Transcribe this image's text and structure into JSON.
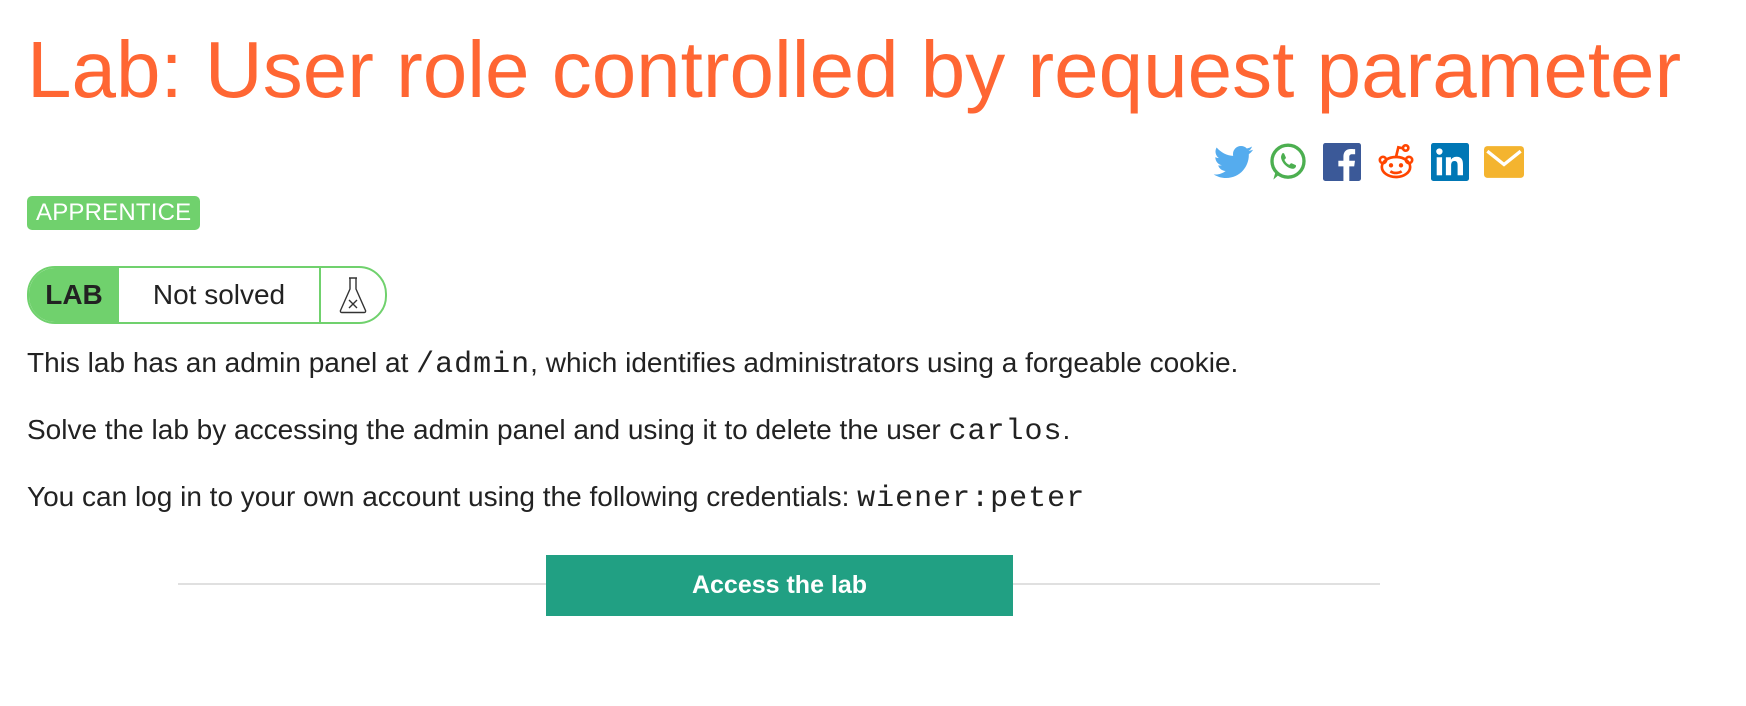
{
  "title": "Lab: User role controlled by request parameter",
  "share": {
    "icons": [
      "twitter-icon",
      "whatsapp-icon",
      "facebook-icon",
      "reddit-icon",
      "linkedin-icon",
      "email-icon"
    ],
    "colors": {
      "twitter": "#55acee",
      "whatsapp": "#4caf50",
      "facebook": "#3b5998",
      "reddit": "#ff4500",
      "linkedin": "#0077b5",
      "email": "#f4b42f"
    }
  },
  "level": "APPRENTICE",
  "status": {
    "tag": "LAB",
    "text": "Not solved",
    "icon": "flask-icon"
  },
  "description": {
    "p1_before": "This lab has an admin panel at ",
    "p1_code": "/admin",
    "p1_after": ", which identifies administrators using a forgeable cookie.",
    "p2_before": "Solve the lab by accessing the admin panel and using it to delete the user ",
    "p2_code": "carlos",
    "p2_after": ".",
    "p3_before": "You can log in to your own account using the following credentials: ",
    "p3_code": "wiener:peter"
  },
  "access_button": "Access the lab",
  "colors": {
    "title": "#ff6633",
    "accent_green": "#70d16d",
    "button": "#21a083"
  }
}
